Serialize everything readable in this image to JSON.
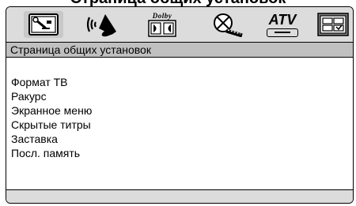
{
  "page_heading": "Страница общих установок",
  "toolbar": {
    "icons": [
      {
        "name": "general-setup-icon",
        "active": true
      },
      {
        "name": "audio-speaker-icon",
        "active": false
      },
      {
        "name": "dolby-icon",
        "active": false,
        "label": "Dolby"
      },
      {
        "name": "video-film-icon",
        "active": false
      },
      {
        "name": "atv-icon",
        "active": false,
        "label": "ATV"
      },
      {
        "name": "preferences-grid-icon",
        "active": false
      }
    ]
  },
  "title_bar": {
    "label": "Страница общих установок"
  },
  "menu": {
    "items": [
      "Формат ТВ",
      "Ракурс",
      "Экранное меню",
      "Скрытые титры",
      "Заставка",
      "Посл. память"
    ]
  },
  "status_bar": {
    "text": ""
  },
  "colors": {
    "toolbar_bg": "#dcdcdc",
    "title_bar_bg": "#c0c0c0",
    "status_bar_bg": "#dcdcdc",
    "text": "#000000"
  }
}
